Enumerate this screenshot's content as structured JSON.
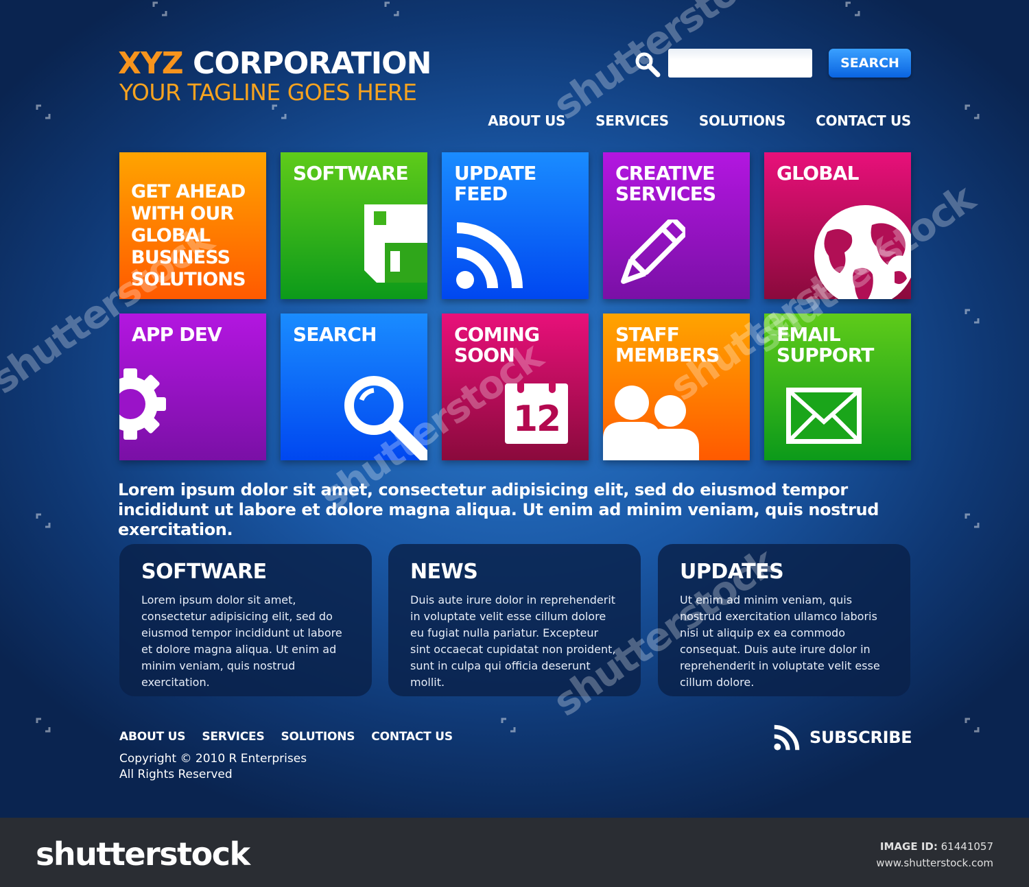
{
  "header": {
    "brand_accent": "XYZ",
    "brand_main": "CORPORATION",
    "tagline": "YOUR TAGLINE GOES HERE",
    "search_button": "SEARCH",
    "search_placeholder": ""
  },
  "nav": [
    "ABOUT US",
    "SERVICES",
    "SOLUTIONS",
    "CONTACT US"
  ],
  "tiles": [
    {
      "title": "GET AHEAD\nWITH OUR\nGLOBAL\nBUSINESS\nSOLUTIONS",
      "icon": "none",
      "colors": [
        "#ffa400",
        "#ff5a00"
      ]
    },
    {
      "title": "SOFTWARE",
      "icon": "floppy-disk-icon",
      "colors": [
        "#5fcb1a",
        "#0c9a1a"
      ]
    },
    {
      "title": "UPDATE\nFEED",
      "icon": "rss-icon",
      "colors": [
        "#1a8cff",
        "#0047f0"
      ]
    },
    {
      "title": "CREATIVE\nSERVICES",
      "icon": "pencil-icon",
      "colors": [
        "#b316e0",
        "#7a10a6"
      ]
    },
    {
      "title": "GLOBAL",
      "icon": "globe-icon",
      "colors": [
        "#e8107a",
        "#8a0a3c"
      ]
    },
    {
      "title": "APP DEV",
      "icon": "gear-icon",
      "colors": [
        "#b316e0",
        "#7a10a6"
      ]
    },
    {
      "title": "SEARCH",
      "icon": "magnifier-icon",
      "colors": [
        "#1a8cff",
        "#0047f0"
      ]
    },
    {
      "title": "COMING\nSOON",
      "icon": "calendar-icon",
      "colors": [
        "#e8107a",
        "#8a0a3c"
      ]
    },
    {
      "title": "STAFF\nMEMBERS",
      "icon": "people-icon",
      "colors": [
        "#ffa400",
        "#ff5a00"
      ]
    },
    {
      "title": "EMAIL\nSUPPORT",
      "icon": "envelope-icon",
      "colors": [
        "#5fcb1a",
        "#0c9a1a"
      ]
    }
  ],
  "calendar_day": "12",
  "lead_text": "Lorem ipsum dolor sit amet, consectetur adipisicing elit, sed do eiusmod tempor incididunt ut labore et dolore magna aliqua. Ut enim ad minim veniam, quis nostrud exercitation.",
  "panels": [
    {
      "title": "SOFTWARE",
      "body": "Lorem ipsum dolor sit amet, consectetur adipisicing elit, sed do eiusmod tempor incididunt ut labore et dolore magna aliqua. Ut enim ad minim veniam, quis nostrud exercitation."
    },
    {
      "title": "NEWS",
      "body": "Duis aute irure dolor in reprehenderit in voluptate velit esse cillum dolore eu fugiat nulla pariatur. Excepteur sint occaecat cupidatat non proident, sunt in culpa qui officia deserunt mollit."
    },
    {
      "title": "UPDATES",
      "body": "Ut enim ad minim veniam, quis nostrud exercitation ullamco laboris nisi ut aliquip ex ea commodo consequat. Duis aute irure dolor in reprehenderit in voluptate velit esse cillum dolore."
    }
  ],
  "footer": {
    "nav": [
      "ABOUT US",
      "SERVICES",
      "SOLUTIONS",
      "CONTACT US"
    ],
    "copyright": "Copyright © 2010 R Enterprises",
    "rights": "All Rights Reserved",
    "subscribe": "SUBSCRIBE"
  },
  "watermark": {
    "logo": "shutterstock",
    "image_id_label": "IMAGE ID:",
    "image_id": "61441057",
    "url": "www.shutterstock.com"
  },
  "colors": {
    "accent_orange": "#f7941d",
    "search_button": "#0a64e0",
    "panel_bg": "#0a2149",
    "footer_bar": "#2a2d33"
  }
}
